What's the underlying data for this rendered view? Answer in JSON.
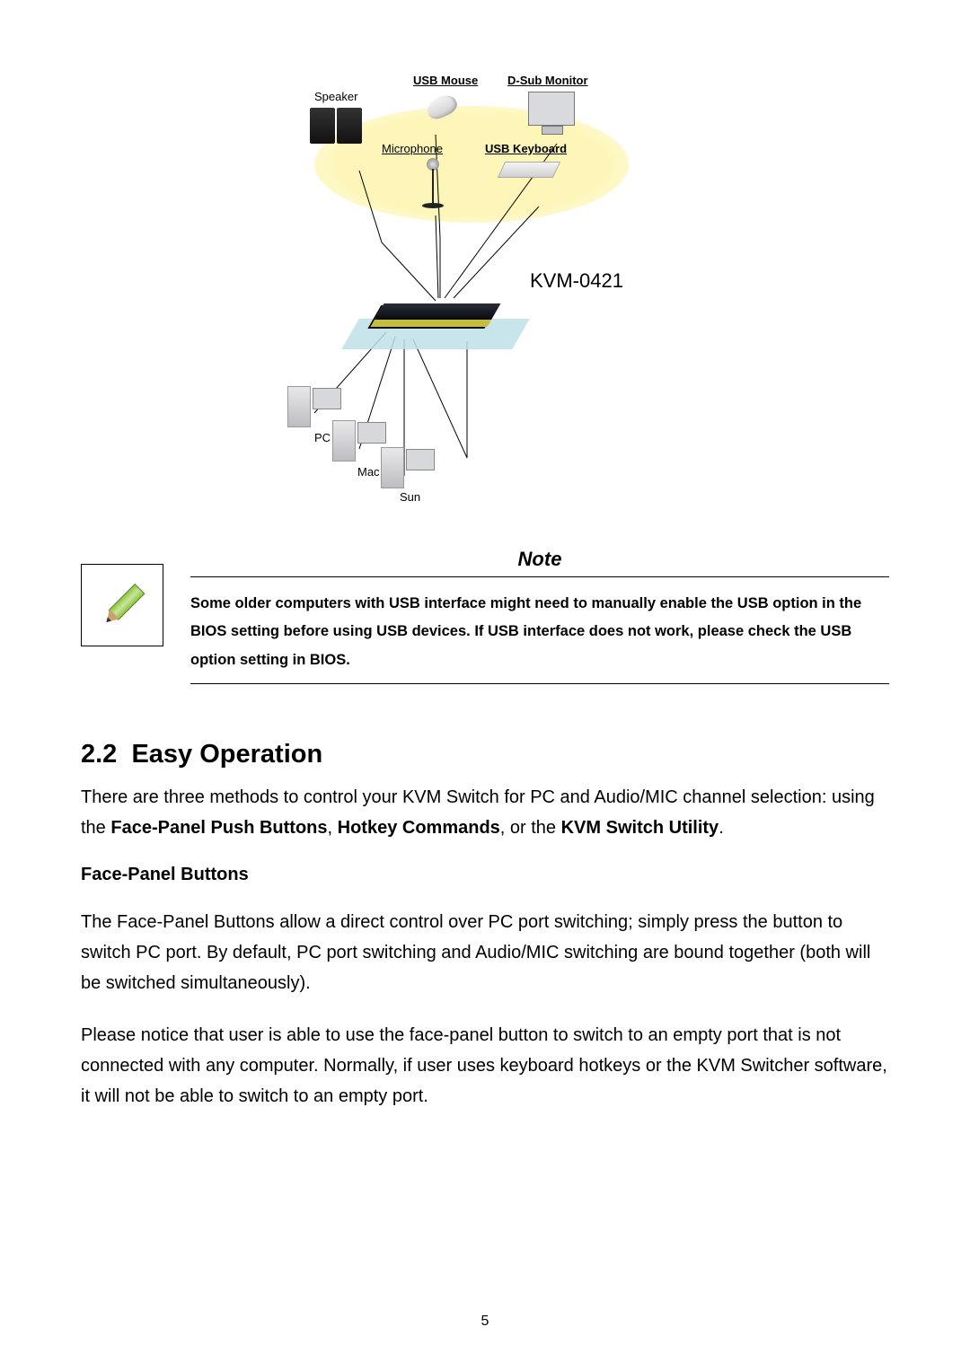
{
  "diagram": {
    "labels": {
      "speaker": "Speaker",
      "usb_mouse": "USB Mouse",
      "dsub_monitor": "D-Sub Monitor",
      "microphone": "Microphone",
      "usb_keyboard": "USB Keyboard",
      "kvm_model": "KVM-0421",
      "pc": "PC",
      "mac": "Mac",
      "sun": "Sun"
    }
  },
  "note": {
    "title": "Note",
    "text": "Some older computers with USB interface might need to manually enable the USB option in the BIOS setting before using USB devices. If USB interface does not work, please check the USB option setting in BIOS."
  },
  "section": {
    "number": "2.2",
    "title": "Easy Operation",
    "intro_pre": "There are three methods to control your KVM Switch for PC and Audio/MIC channel selection: using the ",
    "bold1": "Face-Panel Push Buttons",
    "sep1": ", ",
    "bold2": "Hotkey Commands",
    "sep2": ", or the ",
    "bold3": "KVM Switch Utility",
    "intro_post": ".",
    "sub_heading": "Face-Panel Buttons",
    "para2": "The Face-Panel Buttons allow a direct control over PC port switching; simply press the button to switch PC port. By default, PC port switching and Audio/MIC switching are bound together (both will be switched simultaneously).",
    "para3": "Please notice that user is able to use the face-panel button to switch to an empty port that is not connected with any computer. Normally, if user uses keyboard hotkeys or the KVM Switcher software, it will not be able to switch to an empty port."
  },
  "page_number": "5"
}
